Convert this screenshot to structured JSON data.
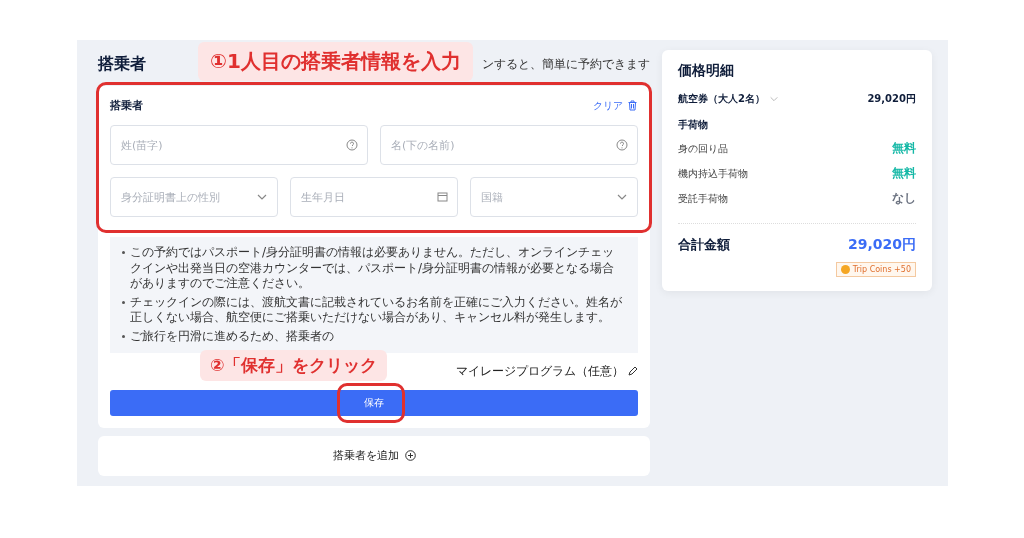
{
  "passenger_section": {
    "title": "搭乗者",
    "hint": "ンすると、簡単に予約できます"
  },
  "passenger_card": {
    "title": "搭乗者",
    "clear_label": "クリア",
    "name_fields": [
      {
        "placeholder": "姓(苗字)"
      },
      {
        "placeholder": "名(下の名前)"
      }
    ],
    "detail_fields": [
      {
        "kind": "select",
        "placeholder": "身分証明書上の性別"
      },
      {
        "kind": "date",
        "placeholder": "生年月日"
      },
      {
        "kind": "select",
        "placeholder": "国籍"
      }
    ],
    "notices": [
      "この予約ではパスポート/身分証明書の情報は必要ありません。ただし、オンラインチェックインや出発当日の空港カウンターでは、パスポート/身分証明書の情報が必要となる場合がありますのでご注意ください。",
      "チェックインの際には、渡航文書に記載されているお名前を正確にご入力ください。姓名が正しくない場合、航空便にご搭乗いただけない場合があり、キャンセル料が発生します。",
      "ご旅行を円滑に進めるため、搭乗者の"
    ],
    "mileage_label": "マイレージプログラム（任意）",
    "save_label": "保存"
  },
  "add_passenger": "搭乗者を追加",
  "price_card": {
    "title": "価格明細",
    "ticket_label": "航空券（大人2名）",
    "ticket_price": "29,020円",
    "baggage_title": "手荷物",
    "baggage": [
      {
        "label": "身の回り品",
        "value": "無料",
        "color": "#14b8a6"
      },
      {
        "label": "機内持込手荷物",
        "value": "無料",
        "color": "#14b8a6"
      },
      {
        "label": "受託手荷物",
        "value": "なし",
        "color": "#6b7280"
      }
    ],
    "total_label": "合計金額",
    "total_price": "29,020円",
    "coins": "Trip Coins +50"
  },
  "annotations": [
    "①1人目の搭乗者情報を入力",
    "②「保存」をクリック"
  ]
}
